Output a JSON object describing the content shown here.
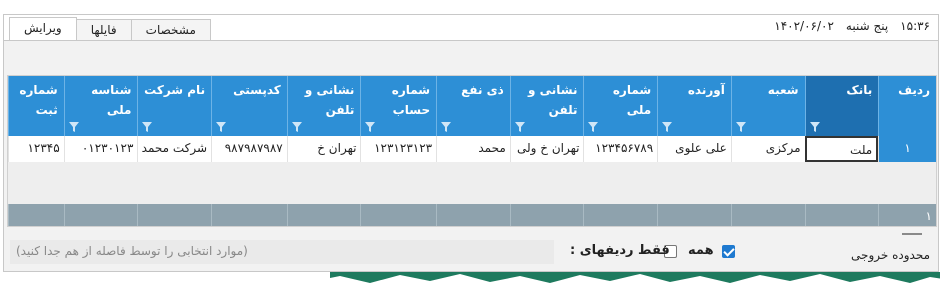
{
  "header": {
    "time": "۱۵:۳۶",
    "day": "پنج شنبه",
    "date": "۱۴۰۲/۰۶/۰۲",
    "tabs": [
      {
        "label": "ویرایش",
        "active": true
      },
      {
        "label": "فایلها",
        "active": false
      },
      {
        "label": "مشخصات",
        "active": false
      }
    ]
  },
  "grid": {
    "columns": [
      {
        "label": "ردیف"
      },
      {
        "label": "بانک"
      },
      {
        "label": "شعبه"
      },
      {
        "label": "آورنده"
      },
      {
        "label": "شماره ملی"
      },
      {
        "label": "نشانی و تلفن"
      },
      {
        "label": "ذی نفع"
      },
      {
        "label": "شماره حساب"
      },
      {
        "label": "نشانی و تلفن"
      },
      {
        "label": "کدپستی"
      },
      {
        "label": "نام شرکت"
      },
      {
        "label": "شناسه ملی"
      },
      {
        "label": "شماره ثبت"
      }
    ],
    "rows": [
      [
        "۱",
        "ملت",
        "مرکزی",
        "علی علوی",
        "۱۲۳۴۵۶۷۸۹",
        "تهران خ ولی",
        "محمد",
        "۱۲۳۱۲۳۱۲۳",
        "تهران خ",
        "۹۸۷۹۸۷۹۸۷",
        "شرکت محمد",
        "۰۱۲۳۰۱۲۳",
        "۱۲۳۴۵"
      ]
    ],
    "footer_count": "۱"
  },
  "options": {
    "output_range_label": "محدوده خروجی",
    "all_label": "همه",
    "all_checked": true,
    "rows_only_label": "فقط ردیفهای :",
    "rows_only_checked": false,
    "hint": "(موارد انتخابی را توسط فاصله از هم جدا کنید)"
  },
  "colors": {
    "header_blue": "#2d8fd6",
    "selected_header": "#1e6fb0",
    "footer_gray": "#8ea2ad"
  }
}
